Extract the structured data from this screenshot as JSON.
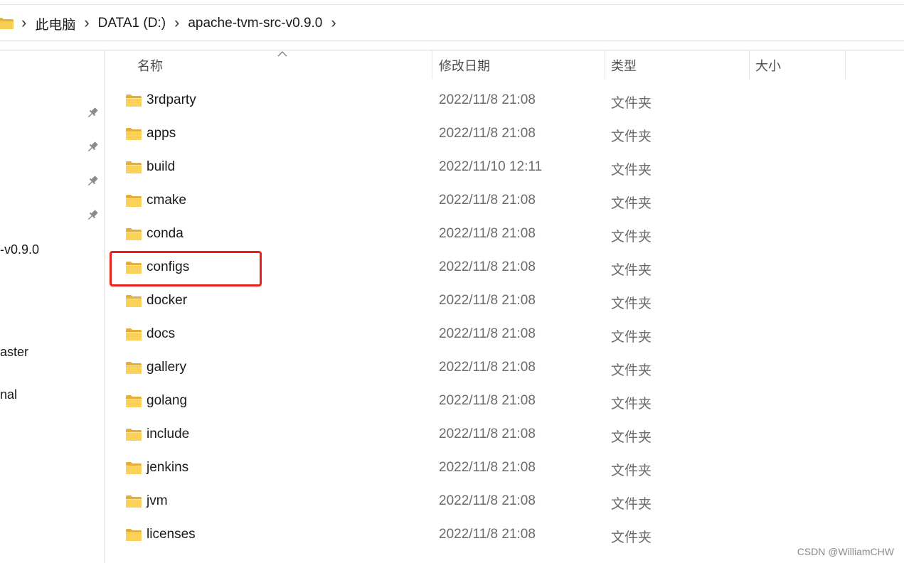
{
  "address_bar": {
    "icon": "folder-icon",
    "breadcrumbs": [
      "此电脑",
      "DATA1 (D:)",
      "apache-tvm-src-v0.9.0"
    ]
  },
  "nav_pane": {
    "pin_icon": "pin-icon",
    "items": [
      {
        "label": "-v0.9.0"
      },
      {
        "label": "aster"
      },
      {
        "label": "nal"
      }
    ]
  },
  "columns": {
    "name": "名称",
    "modified": "修改日期",
    "type": "类型",
    "size": "大小"
  },
  "files": [
    {
      "name": "3rdparty",
      "date": "2022/11/8 21:08",
      "type": "文件夹"
    },
    {
      "name": "apps",
      "date": "2022/11/8 21:08",
      "type": "文件夹"
    },
    {
      "name": "build",
      "date": "2022/11/10 12:11",
      "type": "文件夹"
    },
    {
      "name": "cmake",
      "date": "2022/11/8 21:08",
      "type": "文件夹"
    },
    {
      "name": "conda",
      "date": "2022/11/8 21:08",
      "type": "文件夹"
    },
    {
      "name": "configs",
      "date": "2022/11/8 21:08",
      "type": "文件夹",
      "highlighted": true
    },
    {
      "name": "docker",
      "date": "2022/11/8 21:08",
      "type": "文件夹"
    },
    {
      "name": "docs",
      "date": "2022/11/8 21:08",
      "type": "文件夹"
    },
    {
      "name": "gallery",
      "date": "2022/11/8 21:08",
      "type": "文件夹"
    },
    {
      "name": "golang",
      "date": "2022/11/8 21:08",
      "type": "文件夹"
    },
    {
      "name": "include",
      "date": "2022/11/8 21:08",
      "type": "文件夹"
    },
    {
      "name": "jenkins",
      "date": "2022/11/8 21:08",
      "type": "文件夹"
    },
    {
      "name": "jvm",
      "date": "2022/11/8 21:08",
      "type": "文件夹"
    },
    {
      "name": "licenses",
      "date": "2022/11/8 21:08",
      "type": "文件夹"
    }
  ],
  "colors": {
    "highlight": "#e8221a",
    "folder": "#f8c94a"
  },
  "watermark": "CSDN @WilliamCHW"
}
